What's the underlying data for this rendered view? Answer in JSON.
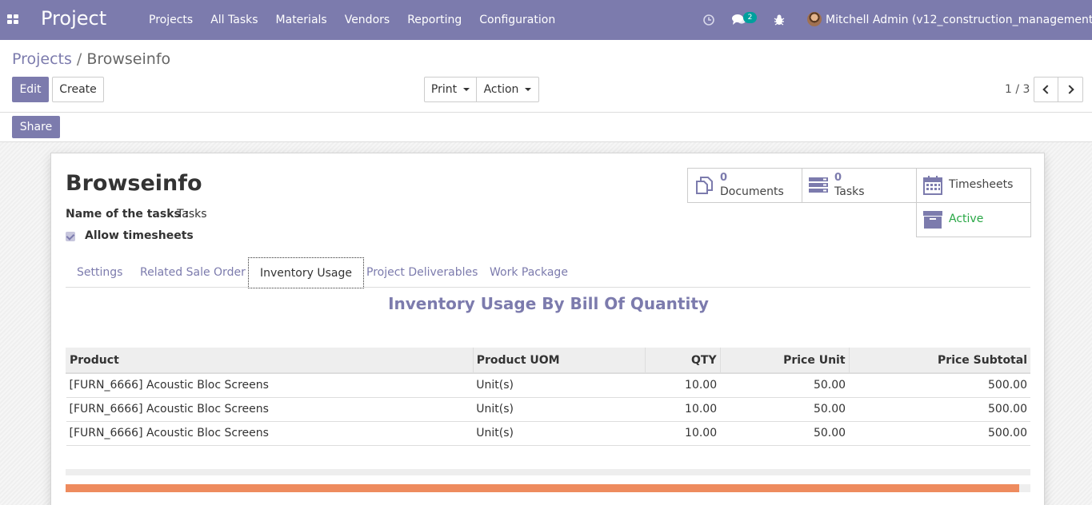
{
  "navbar": {
    "brand": "Project",
    "menu": [
      "Projects",
      "All Tasks",
      "Materials",
      "Vendors",
      "Reporting",
      "Configuration"
    ],
    "chat_badge": "2",
    "user": "Mitchell Admin (v12_construction_management)",
    "color": "#7c7bad"
  },
  "breadcrumb": {
    "parent": "Projects",
    "separator": "/",
    "current": "Browseinfo"
  },
  "buttons": {
    "edit": "Edit",
    "create": "Create",
    "print": "Print",
    "action": "Action",
    "share": "Share"
  },
  "pager": {
    "value": "1 / 3"
  },
  "form": {
    "title": "Browseinfo",
    "tasks_label": "Name of the tasks :",
    "tasks_value": "Tasks",
    "allow_timesheets_label": "Allow timesheets",
    "allow_timesheets_checked": true
  },
  "smart_buttons": {
    "documents": {
      "count": "0",
      "label": "Documents"
    },
    "tasks": {
      "count": "0",
      "label": "Tasks"
    },
    "timesheets": {
      "label": "Timesheets"
    },
    "active": {
      "label": "Active",
      "color": "#28a745"
    }
  },
  "tabs": [
    "Settings",
    "Related Sale Order",
    "Inventory Usage",
    "Project Deliverables",
    "Work Package"
  ],
  "active_tab": "Inventory Usage",
  "section_title": "Inventory Usage By Bill Of Quantity",
  "table": {
    "headers": [
      "Product",
      "Product UOM",
      "QTY",
      "Price Unit",
      "Price Subtotal"
    ],
    "rows": [
      [
        "[FURN_6666] Acoustic Bloc Screens",
        "Unit(s)",
        "10.00",
        "50.00",
        "500.00"
      ],
      [
        "[FURN_6666] Acoustic Bloc Screens",
        "Unit(s)",
        "10.00",
        "50.00",
        "500.00"
      ],
      [
        "[FURN_6666] Acoustic Bloc Screens",
        "Unit(s)",
        "10.00",
        "50.00",
        "500.00"
      ]
    ]
  },
  "progress": {
    "fraction": 0.988,
    "color": "#ee8b5e"
  }
}
